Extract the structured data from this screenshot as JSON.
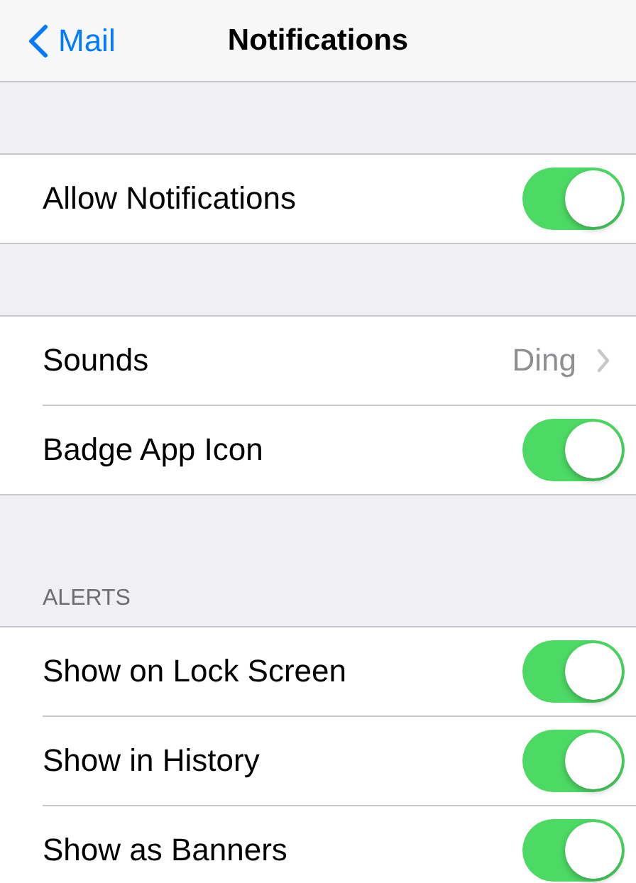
{
  "nav": {
    "back_label": "Mail",
    "title": "Notifications"
  },
  "sections": [
    {
      "rows": [
        {
          "kind": "toggle",
          "label": "Allow Notifications",
          "on": true
        }
      ]
    },
    {
      "rows": [
        {
          "kind": "detail",
          "label": "Sounds",
          "value": "Ding"
        },
        {
          "kind": "toggle",
          "label": "Badge App Icon",
          "on": true
        }
      ]
    },
    {
      "header": "ALERTS",
      "rows": [
        {
          "kind": "toggle",
          "label": "Show on Lock Screen",
          "on": true
        },
        {
          "kind": "toggle",
          "label": "Show in History",
          "on": true
        },
        {
          "kind": "toggle",
          "label": "Show as Banners",
          "on": true
        }
      ]
    }
  ]
}
